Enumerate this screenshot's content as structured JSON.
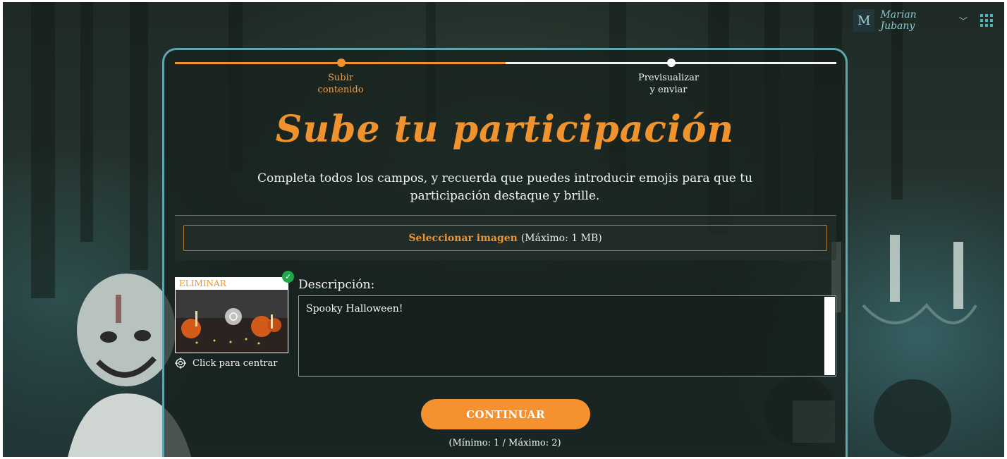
{
  "header": {
    "avatar_initial": "M",
    "user_name": "Marian Jubany",
    "apps_icon": "grid-apps-icon"
  },
  "steps": [
    {
      "label_line1": "Subir",
      "label_line2": "contenido",
      "state": "active"
    },
    {
      "label_line1": "Previsualizar",
      "label_line2": "y enviar",
      "state": "pending"
    }
  ],
  "progress_fraction": 0.5,
  "form": {
    "title": "Sube tu participación",
    "subtitle": "Completa todos los campos, y recuerda que puedes introducir emojis para que tu participación destaque y brille.",
    "upload": {
      "action_label": "Seleccionar imagen",
      "limit_label": "(Máximo: 1 MB)"
    },
    "image": {
      "remove_label": "ELIMINAR",
      "center_label": "Click para centrar"
    },
    "description": {
      "label": "Descripción:",
      "value": "Spooky Halloween!"
    },
    "continue_label": "CONTINUAR",
    "limits_label": "(Mínimo: 1 / Máximo: 2)"
  },
  "colors": {
    "accent": "#f0922d",
    "card_border": "#5da7ad",
    "check": "#1fa84a"
  }
}
